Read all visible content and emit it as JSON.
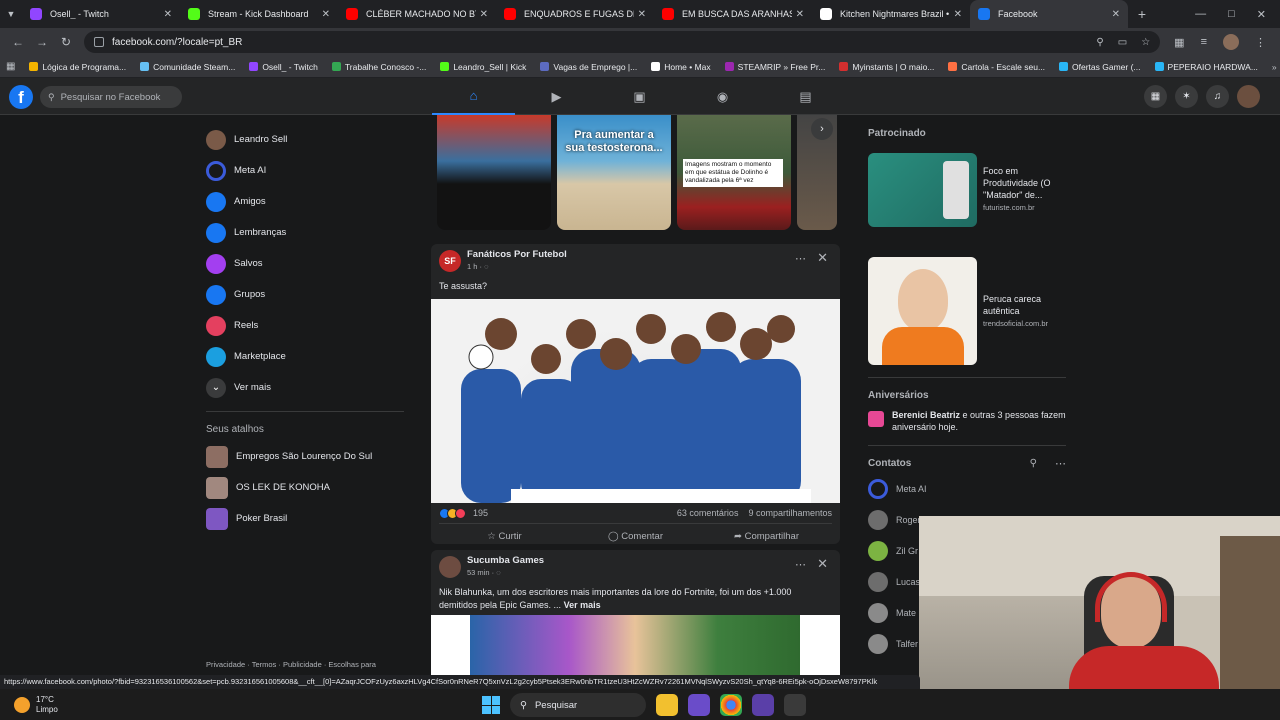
{
  "browser": {
    "tabs": [
      {
        "title": "Osell_ - Twitch",
        "color": "#9146ff"
      },
      {
        "title": "Stream - Kick Dashboard",
        "color": "#53fc18"
      },
      {
        "title": "CLÉBER MACHADO NO BT",
        "color": "#ff0000"
      },
      {
        "title": "ENQUADROS E FUGAS DE MO",
        "color": "#ff0000"
      },
      {
        "title": "EM BUSCA DAS ARANHAS TAR",
        "color": "#ff0000"
      },
      {
        "title": "Kitchen Nightmares Brazil • HB",
        "color": "#ffffff"
      },
      {
        "title": "Facebook",
        "color": "#1877f2"
      }
    ],
    "active_tab": 6,
    "url": "facebook.com/?locale=pt_BR",
    "bookmarks": [
      {
        "label": "Lógica de Programa...",
        "color": "#f4b400"
      },
      {
        "label": "Comunidade Steam...",
        "color": "#66c0f4"
      },
      {
        "label": "Osell_ - Twitch",
        "color": "#9146ff"
      },
      {
        "label": "Trabalhe Conosco -...",
        "color": "#34a853"
      },
      {
        "label": "Leandro_Sell | Kick",
        "color": "#53fc18"
      },
      {
        "label": "Vagas de Emprego |...",
        "color": "#5c6bc0"
      },
      {
        "label": "Home • Max",
        "color": "#ffffff"
      },
      {
        "label": "STEAMRIP » Free Pr...",
        "color": "#9c27b0"
      },
      {
        "label": "Myinstants | O maio...",
        "color": "#d32f2f"
      },
      {
        "label": "Cartola - Escale seu...",
        "color": "#ff7043"
      },
      {
        "label": "Ofertas Gamer (...",
        "color": "#29b6f6"
      },
      {
        "label": "PEPERAIO HARDWA...",
        "color": "#29b6f6"
      }
    ]
  },
  "fb": {
    "search_placeholder": "Pesquisar no Facebook",
    "logo": "f",
    "left_nav": [
      {
        "label": "Leandro Sell",
        "icon": "profile-avatar",
        "color": "#7a5a48"
      },
      {
        "label": "Meta AI",
        "icon": "meta-ai-ring",
        "color": "#3b5bdb"
      },
      {
        "label": "Amigos",
        "icon": "friends-icon",
        "color": "#1877f2"
      },
      {
        "label": "Lembranças",
        "icon": "memories-clock-icon",
        "color": "#1877f2"
      },
      {
        "label": "Salvos",
        "icon": "bookmark-icon",
        "color": "#a33ff0"
      },
      {
        "label": "Grupos",
        "icon": "groups-icon",
        "color": "#1877f2"
      },
      {
        "label": "Reels",
        "icon": "reels-icon",
        "color": "#e4405f"
      },
      {
        "label": "Marketplace",
        "icon": "marketplace-icon",
        "color": "#1b9fe0"
      },
      {
        "label": "Ver mais",
        "icon": "chevron-down-icon",
        "color": "#3a3b3c"
      }
    ],
    "shortcuts_title": "Seus atalhos",
    "shortcuts": [
      {
        "label": "Empregos São Lourenço Do Sul",
        "color": "#8d6e63"
      },
      {
        "label": "OS LEK DE KONOHA",
        "color": "#a1887f"
      },
      {
        "label": "Poker Brasil",
        "color": "#7e57c2"
      }
    ],
    "footer": "Privacidade · Termos · Publicidade · Escolhas para",
    "stories": [
      {
        "caption": ""
      },
      {
        "caption": "Pra aumentar a sua testosterona..."
      },
      {
        "caption": "Imagens mostram o momento em que estátua de Dolinho é vandalizada pela 6ª vez"
      },
      {
        "caption": ""
      }
    ],
    "post1": {
      "author": "Fanáticos Por Futebol",
      "avatar_text": "SF",
      "time": "1 h",
      "text": "Te assusta?",
      "reactions": "195",
      "comments": "63 comentários",
      "shares": "9 compartilhamentos",
      "like": "Curtir",
      "comment": "Comentar",
      "share": "Compartilhar"
    },
    "post2": {
      "author": "Sucumba Games",
      "time": "53 min",
      "text": "Nik Blahunka, um dos escritores mais importantes da lore do Fortnite, foi um dos +1.000 demitidos pela Epic Games. ...",
      "see_more": "Ver mais"
    },
    "right": {
      "sponsored_title": "Patrocinado",
      "ads": [
        {
          "title": "Foco em Produtividade (O \"Matador\" de...",
          "domain": "futuriste.com.br"
        },
        {
          "title": "Peruca careca autêntica",
          "domain": "trendsoficial.com.br"
        }
      ],
      "birthdays_title": "Aniversários",
      "birthday_text_bold": "Berenici Beatriz",
      "birthday_text": " e outras 3 pessoas fazem aniversário hoje.",
      "contacts_title": "Contatos",
      "contacts": [
        {
          "name": "Meta AI",
          "color": "#3b5bdb"
        },
        {
          "name": "Roger",
          "color": "#6d6d6d"
        },
        {
          "name": "Zil Gr",
          "color": "#7cb342"
        },
        {
          "name": "Lucas",
          "color": "#6d6d6d"
        },
        {
          "name": "Mate",
          "color": "#8a8a8a"
        },
        {
          "name": "Talfer",
          "color": "#8a8a8a"
        }
      ]
    }
  },
  "status_url": "https://www.facebook.com/photo/?fbid=932316536100562&set=pcb.932316561005608&__cft__[0]=AZaqrJCOFzUyz6axzHLVg4CfSor0nRNeR7Q5xnVzL2g2cyb5Ptsek3ERw0nbTR1tzeU3HtZcWZRv72261MVNqlSWyzvS20Sh_qtYq8-6REi5pk-oOjDsxeW8797PKlk",
  "taskbar": {
    "temp": "17°C",
    "condition": "Limpo",
    "search": "Pesquisar"
  }
}
